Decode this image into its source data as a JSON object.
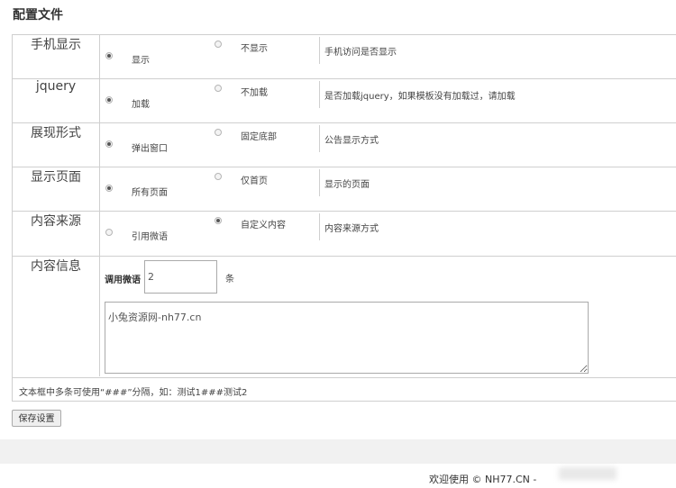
{
  "page_title": "配置文件",
  "rows": [
    {
      "label": "手机显示",
      "opt1": "显示",
      "opt2": "不显示",
      "checked": 1,
      "desc": "手机访问是否显示"
    },
    {
      "label": "jquery",
      "opt1": "加载",
      "opt2": "不加载",
      "checked": 1,
      "desc": "是否加载jquery，如果模板没有加载过，请加载"
    },
    {
      "label": "展现形式",
      "opt1": "弹出窗口",
      "opt2": "固定底部",
      "checked": 1,
      "desc": "公告显示方式"
    },
    {
      "label": "显示页面",
      "opt1": "所有页面",
      "opt2": "仅首页",
      "checked": 1,
      "desc": "显示的页面"
    },
    {
      "label": "内容来源",
      "opt1": "引用微语",
      "opt2": "自定义内容",
      "checked": 2,
      "desc": "内容来源方式"
    }
  ],
  "content_info": {
    "label": "内容信息",
    "call_label": "调用微语",
    "count_value": "2",
    "unit": "条",
    "textarea_value": "小兔资源网-nh77.cn"
  },
  "hint": "文本框中多条可使用“###”分隔，如：测试1###测试2",
  "save_button": "保存设置",
  "footer_text": "欢迎使用 © NH77.CN -"
}
